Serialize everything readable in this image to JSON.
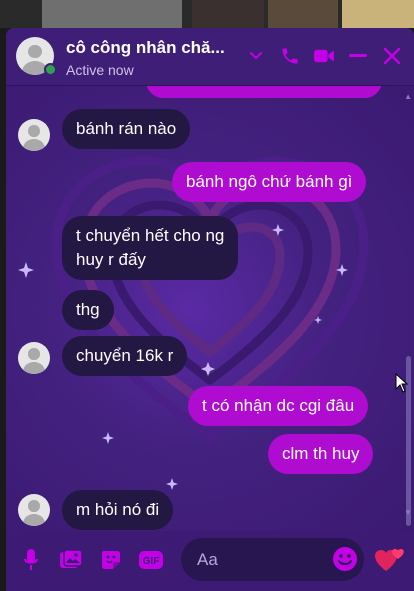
{
  "theme": {
    "accent": "#c400e6",
    "panel": "#3d1a74",
    "outgoing_bubble": "#b00bd0",
    "incoming_bubble": "#231744",
    "online": "#31a24c"
  },
  "header": {
    "contact_name": "cô công nhân chă...",
    "status": "Active now",
    "icons": [
      "chevron-down-icon",
      "phone-icon",
      "video-icon",
      "minimize-icon",
      "close-icon"
    ]
  },
  "messages": [
    {
      "direction": "incoming",
      "text": "bánh rán nào",
      "avatar": true
    },
    {
      "direction": "outgoing",
      "text": "bánh ngô chứ bánh gì"
    },
    {
      "direction": "incoming",
      "text_lines": [
        "t chuyển hết cho ng",
        "huy r đấy"
      ]
    },
    {
      "direction": "incoming",
      "text": "thg"
    },
    {
      "direction": "incoming",
      "text": "chuyển 16k r",
      "avatar": true
    },
    {
      "direction": "outgoing",
      "text": "t có nhận dc cgi đâu"
    },
    {
      "direction": "outgoing",
      "text": "clm th huy"
    },
    {
      "direction": "incoming",
      "text": "m hỏi nó đi",
      "avatar": true
    }
  ],
  "composer": {
    "placeholder": "Aa",
    "icons": [
      "microphone-icon",
      "image-icon",
      "sticker-icon",
      "gif-icon",
      "emoji-icon",
      "heart-reaction-icon"
    ],
    "gif_label": "GIF"
  }
}
